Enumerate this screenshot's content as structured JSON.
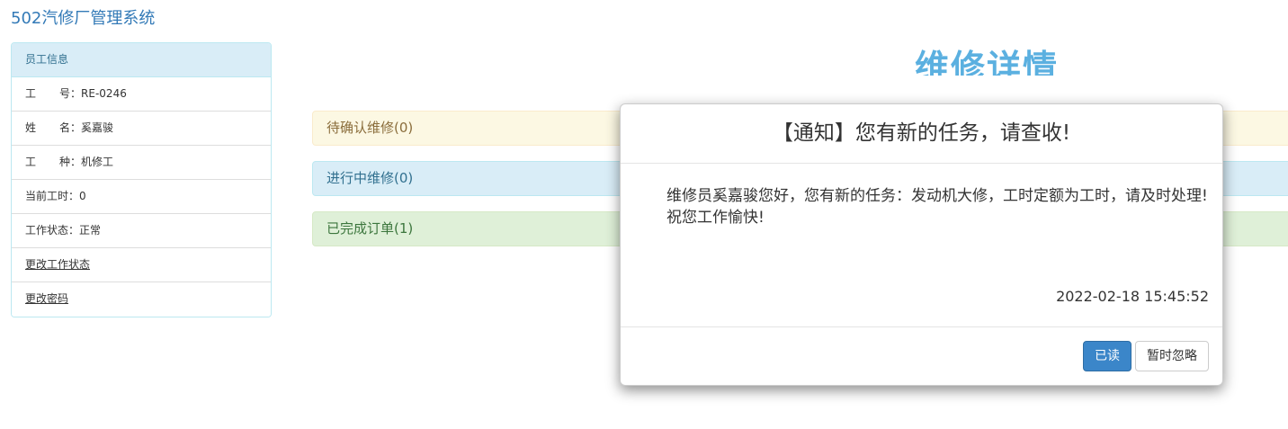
{
  "app": {
    "title": "502汽修厂管理系统"
  },
  "sidebar": {
    "heading": "员工信息",
    "items": [
      {
        "key": "工号",
        "sep": "：",
        "value": "RE-0246"
      },
      {
        "key": "姓名",
        "sep": "：",
        "value": "奚嘉骏"
      },
      {
        "key": "工种",
        "sep": "：",
        "value": "机修工"
      },
      {
        "key": "当前工时",
        "sep": "：",
        "value": "0"
      },
      {
        "key": "工作状态",
        "sep": "：",
        "value": "正常"
      }
    ],
    "links": {
      "change_status": "更改工作状态",
      "change_password": "更改密码"
    }
  },
  "main": {
    "title": "维修详情",
    "bars": {
      "pending": "待确认维修(0)",
      "in_progress": "进行中维修(0)",
      "completed": "已完成订单(1)"
    }
  },
  "modal": {
    "title": "【通知】您有新的任务，请查收!",
    "line1": "维修员奚嘉骏您好，您有新的任务：发动机大修，工时定额为工时，请及时处理!",
    "line2": "祝您工作愉快!",
    "timestamp": "2022-02-18 15:45:52",
    "read_label": "已读",
    "ignore_label": "暂时忽略"
  },
  "colors": {
    "brand": "#337ab7",
    "primary_button": "#3b86c9",
    "info_bg": "#d9edf7",
    "warning_bg": "#fcf8e3",
    "success_bg": "#dff0d8"
  }
}
